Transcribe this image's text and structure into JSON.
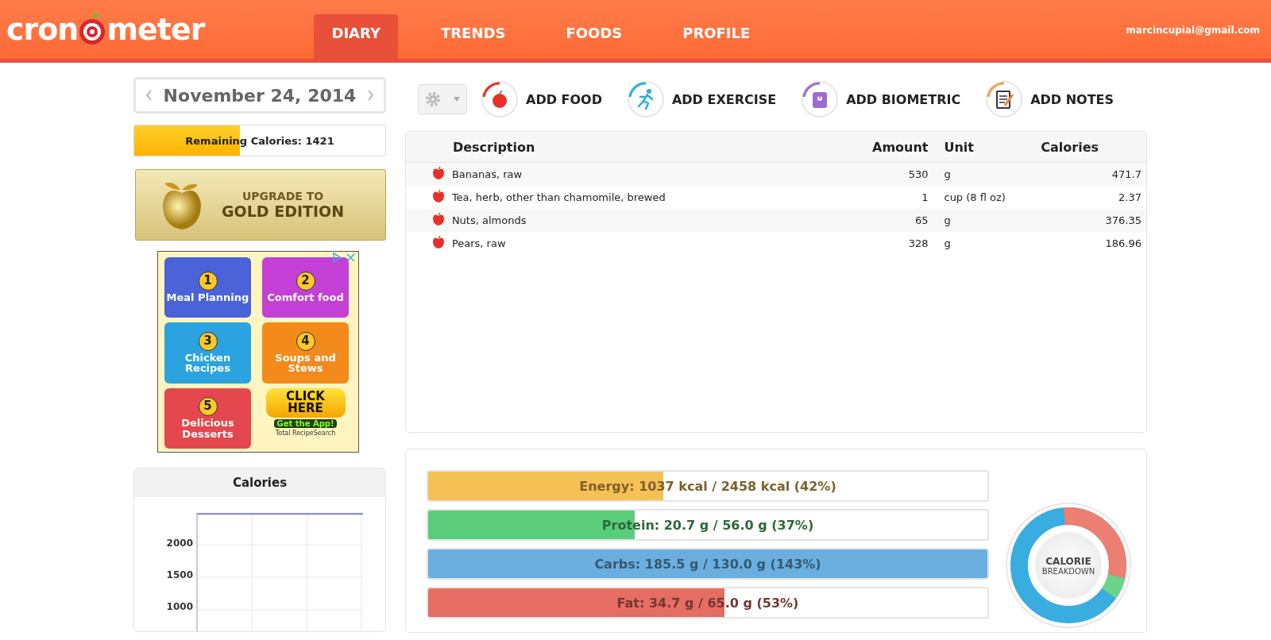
{
  "header": {
    "logo_left": "cron",
    "logo_right": "meter",
    "tabs": [
      {
        "label": "DIARY",
        "selected": true
      },
      {
        "label": "TRENDS",
        "selected": false
      },
      {
        "label": "FOODS",
        "selected": false
      },
      {
        "label": "PROFILE",
        "selected": false
      }
    ],
    "user_email": "marcincupial@gmail.com"
  },
  "sidebar": {
    "date": "November 24, 2014",
    "remaining": {
      "label": "Remaining Calories: 1421",
      "level": 0.42
    },
    "upgrade": {
      "line_1": "UPGRADE TO",
      "line_2": "GOLD EDITION"
    },
    "ad": {
      "tiles": [
        {
          "number": "1",
          "text": "Meal Planning",
          "color": "#4a63d8"
        },
        {
          "number": "2",
          "text": "Comfort food",
          "color": "#c43fd6"
        },
        {
          "number": "3",
          "text": "Chicken Recipes",
          "color": "#2aa3e0"
        },
        {
          "number": "4",
          "text": "Soups and Stews",
          "color": "#f28a1c"
        },
        {
          "number": "5",
          "text": "Delicious Desserts",
          "color": "#e4474e"
        }
      ],
      "cta": "CLICK HERE",
      "cta_sub": "Get the App!",
      "brand": "Total RecipeSearch"
    },
    "calories_chart": {
      "title": "Calories",
      "y_labels": [
        "2000",
        "1500",
        "1000"
      ]
    }
  },
  "toolbar": {
    "actions": [
      {
        "kind": "food",
        "label": "ADD FOOD"
      },
      {
        "kind": "exercise",
        "label": "ADD EXERCISE"
      },
      {
        "kind": "biometric",
        "label": "ADD BIOMETRIC"
      },
      {
        "kind": "notes",
        "label": "ADD NOTES"
      }
    ]
  },
  "table": {
    "columns": [
      "Description",
      "Amount",
      "Unit",
      "Calories"
    ],
    "rows": [
      {
        "description": "Bananas, raw",
        "amount": "530",
        "unit": "g",
        "calories": "471.7"
      },
      {
        "description": "Tea, herb, other than chamomile, brewed",
        "amount": "1",
        "unit": "cup (8 fl oz)",
        "calories": "2.37"
      },
      {
        "description": "Nuts, almonds",
        "amount": "65",
        "unit": "g",
        "calories": "376.35"
      },
      {
        "description": "Pears, raw",
        "amount": "328",
        "unit": "g",
        "calories": "186.96"
      }
    ]
  },
  "targets": [
    {
      "label": "Energy: 1037 kcal / 2458 kcal (42%)",
      "level": 0.42,
      "color": "#f5c155"
    },
    {
      "label": "Protein: 20.7 g / 56.0 g (37%)",
      "level": 0.37,
      "color": "#5acd7a"
    },
    {
      "label": "Carbs: 185.5 g / 130.0 g (143%)",
      "level": 1.0,
      "color": "#6aafe0"
    },
    {
      "label": "Fat: 34.7 g / 65.0 g (53%)",
      "level": 0.53,
      "color": "#e56d63"
    }
  ],
  "breakdown": {
    "line_1": "CALORIE",
    "line_2": "BREAKDOWN"
  }
}
